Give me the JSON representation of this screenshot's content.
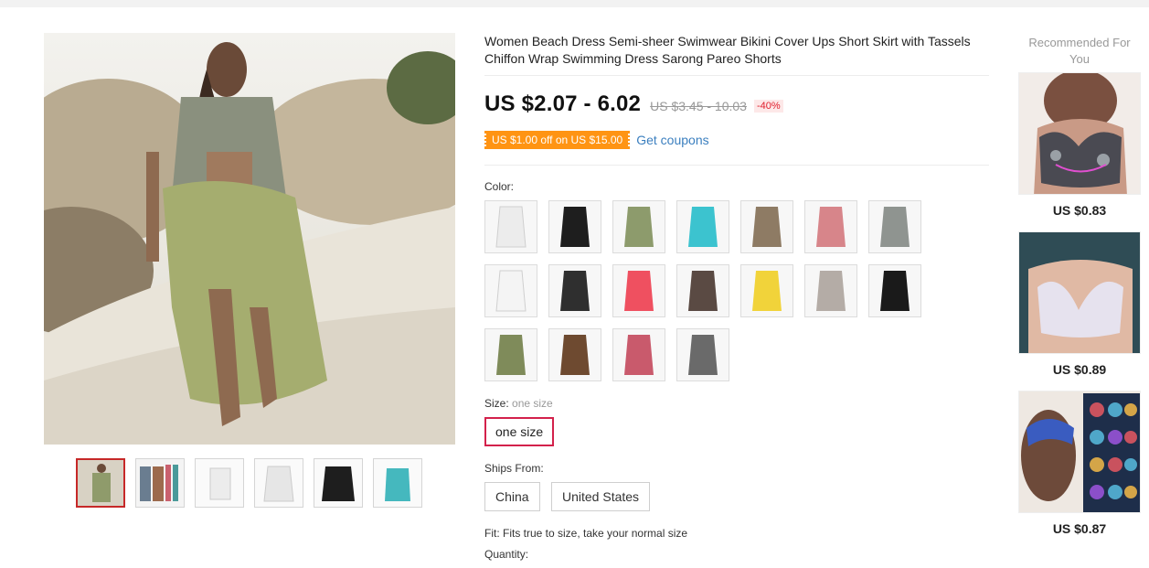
{
  "product": {
    "title": "Women Beach Dress Semi-sheer Swimwear Bikini Cover Ups Short Skirt with Tassels Chiffon Wrap Swimming Dress Sarong Pareo Shorts",
    "price": "US $2.07 - 6.02",
    "original_price": "US $3.45 - 10.03",
    "discount": "-40%",
    "coupon_text": "US $1.00 off on US $15.00",
    "coupon_link": "Get coupons"
  },
  "color": {
    "label": "Color:",
    "swatch_colors": [
      "#ececec",
      "#1e1e1e",
      "#8d9b6c",
      "#3cc3cf",
      "#8e7b64",
      "#d7858a",
      "#8f9490",
      "#f4f4f4",
      "#2f2f2f",
      "#ef5060",
      "#5a4a43",
      "#f1d33a",
      "#b4aca6",
      "#1a1a1a",
      "#7f8b5a",
      "#6e4a30",
      "#c95a6c",
      "#6a6a6a"
    ]
  },
  "size": {
    "label": "Size:",
    "selected": "one size",
    "option": "one size"
  },
  "ships_from": {
    "label": "Ships From:",
    "options": [
      "China",
      "United States"
    ]
  },
  "fit_text": "Fit: Fits true to size, take your normal size",
  "quantity_label": "Quantity:",
  "thumbnails": [
    "#8f9b6b",
    "#6a7d90",
    "#ececec",
    "#e6e6e6",
    "#1e1e1e",
    "#45b8be"
  ],
  "recommended": {
    "title": "Recommended For You",
    "items": [
      {
        "price": "US $0.83"
      },
      {
        "price": "US $0.89"
      },
      {
        "price": "US $0.87"
      }
    ]
  }
}
